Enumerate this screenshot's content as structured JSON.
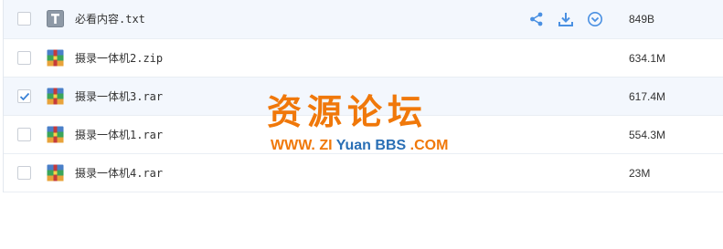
{
  "files": [
    {
      "name": "必看内容.txt",
      "size": "849B",
      "type": "text",
      "checked": false,
      "hover": true
    },
    {
      "name": "摄录一体机2.zip",
      "size": "634.1M",
      "type": "archive",
      "checked": false
    },
    {
      "name": "摄录一体机3.rar",
      "size": "617.4M",
      "type": "archive",
      "checked": true
    },
    {
      "name": "摄录一体机1.rar",
      "size": "554.3M",
      "type": "archive",
      "checked": false
    },
    {
      "name": "摄录一体机4.rar",
      "size": "23M",
      "type": "archive",
      "checked": false
    }
  ],
  "row_actions": {
    "icons": [
      "share-icon",
      "download-icon",
      "more-icon"
    ],
    "color": "#4a90e2"
  },
  "watermark": {
    "title": "资源论坛",
    "url_part1": "WWW.",
    "url_part2": "ZI",
    "url_part3": "Yuan",
    "url_part4": "BBS",
    "url_part5": ".COM"
  },
  "colors": {
    "accent": "#4a90e2",
    "watermark_orange": "#f0780a",
    "watermark_blue": "#2a6fb5"
  }
}
